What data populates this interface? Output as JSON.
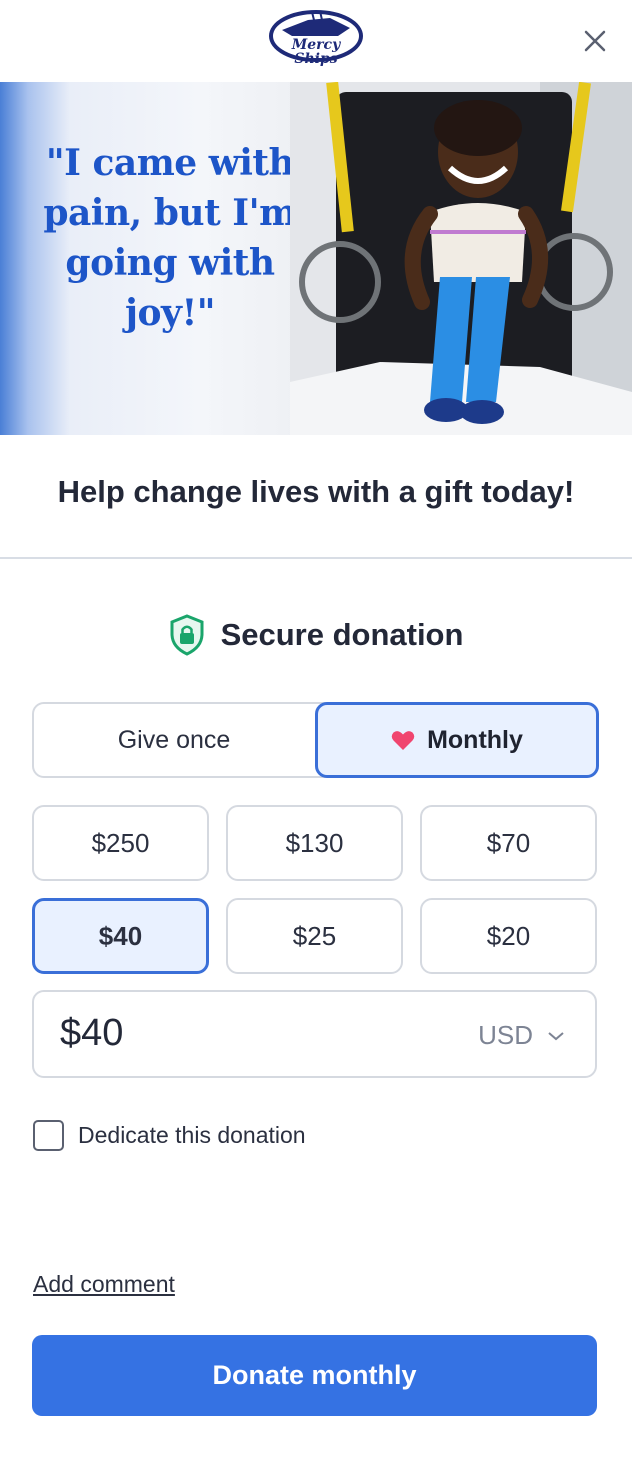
{
  "header": {
    "logo_text_line1": "Mercy",
    "logo_text_line2": "Ships",
    "close_icon": "close-icon"
  },
  "hero": {
    "quote": "\"I came with pain, but I'm going with joy!\""
  },
  "tagline": "Help change lives with a gift today!",
  "secure": {
    "icon": "shield-lock-icon",
    "label": "Secure donation"
  },
  "frequency": {
    "options": [
      {
        "label": "Give once",
        "selected": false
      },
      {
        "label": "Monthly",
        "selected": true,
        "icon": "heart-icon"
      }
    ]
  },
  "amounts": [
    {
      "label": "$250",
      "selected": false
    },
    {
      "label": "$130",
      "selected": false
    },
    {
      "label": "$70",
      "selected": false
    },
    {
      "label": "$40",
      "selected": true
    },
    {
      "label": "$25",
      "selected": false
    },
    {
      "label": "$20",
      "selected": false
    }
  ],
  "amount_input": {
    "value": "$40",
    "currency": "USD",
    "currency_icon": "chevron-down-icon"
  },
  "dedicate": {
    "label": "Dedicate this donation",
    "checked": false
  },
  "add_comment": "Add comment",
  "donate_button": "Donate monthly",
  "colors": {
    "accent": "#3572e3",
    "selected_bg": "#e9f1ff",
    "quote_blue": "#1d55c8",
    "heart": "#f0456f",
    "shield": "#1aa56b"
  }
}
